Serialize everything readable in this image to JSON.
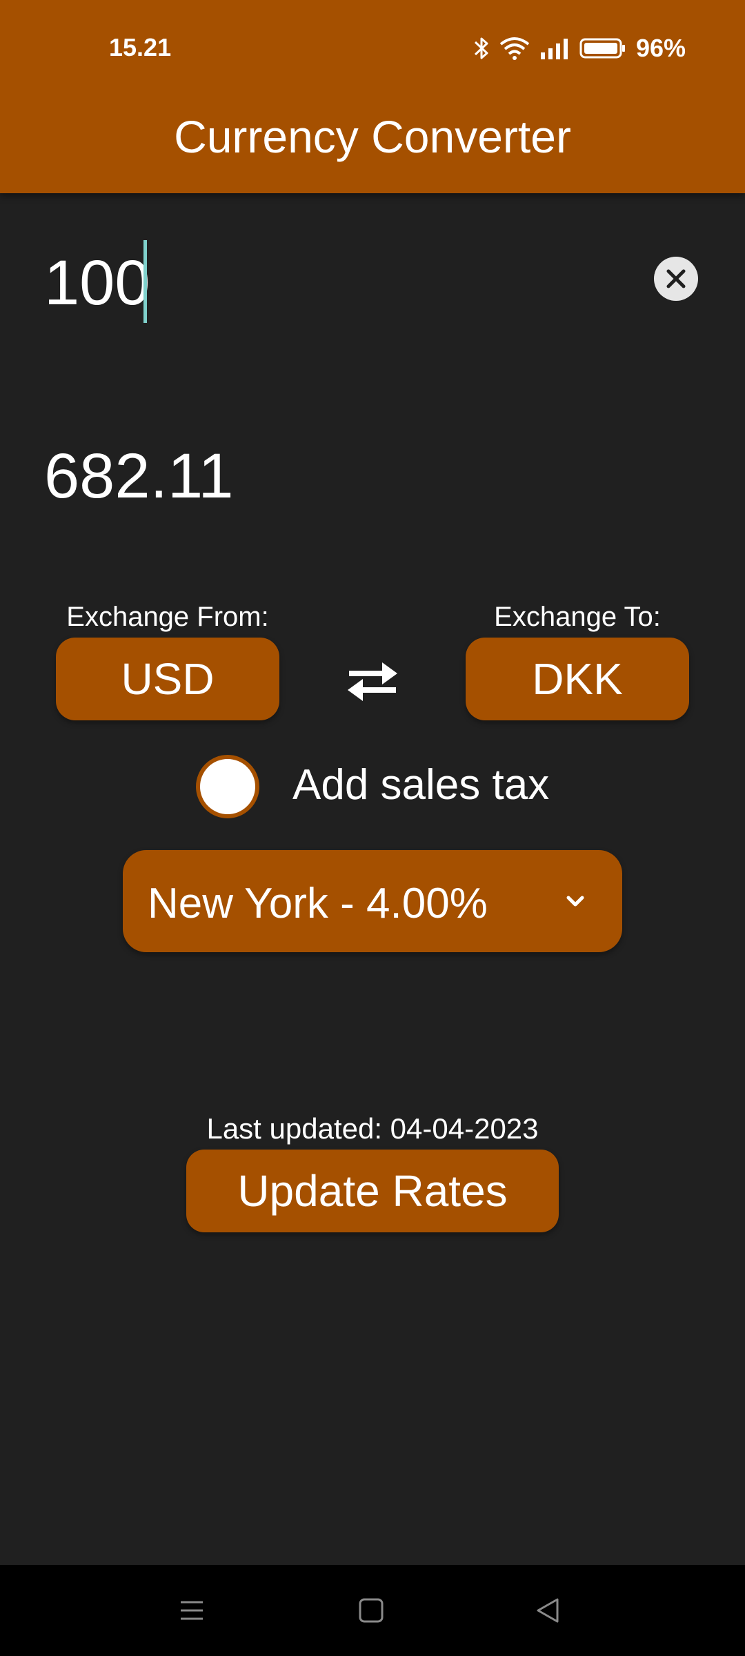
{
  "status_bar": {
    "time": "15.21",
    "battery": "96%",
    "icons": [
      "bluetooth-icon",
      "wifi-icon",
      "signal-icon",
      "battery-icon"
    ]
  },
  "app": {
    "title": "Currency Converter",
    "accent_color": "#A55000",
    "background_color": "#202020"
  },
  "converter": {
    "amount": "100",
    "result": "682.11",
    "from_label": "Exchange From:",
    "from_currency": "USD",
    "to_label": "Exchange To:",
    "to_currency": "DKK"
  },
  "sales_tax": {
    "label": "Add sales tax",
    "checked": false,
    "selected_state": "New York - 4.00%"
  },
  "rates": {
    "last_updated": "Last updated: 04-04-2023",
    "update_button": "Update Rates"
  },
  "nav": {
    "icons": [
      "menu-icon",
      "home-icon",
      "back-icon"
    ]
  }
}
